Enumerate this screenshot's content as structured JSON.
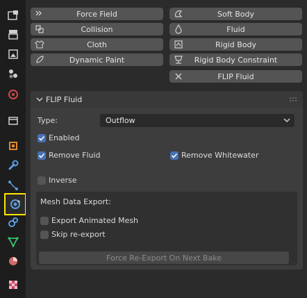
{
  "physics_buttons": {
    "force_field": "Force Field",
    "collision": "Collision",
    "cloth": "Cloth",
    "dynamic_paint": "Dynamic Paint",
    "soft_body": "Soft Body",
    "fluid": "Fluid",
    "rigid_body": "Rigid Body",
    "rigid_body_constraint": "Rigid Body Constraint",
    "flip_fluid": "FLIP Fluid"
  },
  "panel": {
    "title": "FLIP Fluid",
    "type_label": "Type:",
    "type_value": "Outflow",
    "enabled_label": "Enabled",
    "enabled_checked": true,
    "remove_fluid_label": "Remove Fluid",
    "remove_fluid_checked": true,
    "remove_whitewater_label": "Remove Whitewater",
    "remove_whitewater_checked": true,
    "inverse_label": "Inverse",
    "inverse_checked": false,
    "mesh_export": {
      "title": "Mesh Data Export:",
      "export_animated_label": "Export Animated Mesh",
      "export_animated_checked": false,
      "skip_reexport_label": "Skip re-export",
      "skip_reexport_checked": false,
      "force_reexport_label": "Force Re-Export On Next Bake"
    }
  },
  "sidebar_tabs": [
    "tool-tab",
    "render-tab",
    "output-tab",
    "view-layer-tab",
    "scene-tab",
    "world-tab",
    "collection-tab",
    "object-tab",
    "modifiers-tab",
    "particles-tab",
    "physics-tab",
    "constraints-tab",
    "data-tab",
    "material-tab",
    "texture-tab"
  ],
  "colors": {
    "accent_blue": "#4772b3",
    "active_tab_highlight": "#ffe600"
  }
}
